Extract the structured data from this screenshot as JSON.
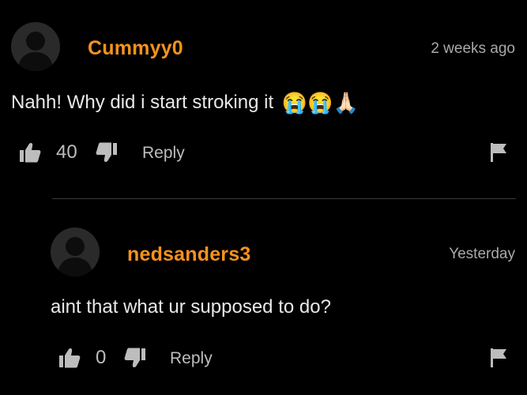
{
  "comments": [
    {
      "username": "Cummyy0",
      "time": "2 weeks ago",
      "text": "Nahh! Why did i start stroking it",
      "emojis": "😭😭🙏🏻",
      "likes": "40",
      "reply_label": "Reply"
    },
    {
      "username": "nedsanders3",
      "time": "Yesterday",
      "text": "aint that what ur supposed to do?",
      "likes": "0",
      "reply_label": "Reply"
    }
  ],
  "colors": {
    "username": "#f7921e",
    "background": "#000000",
    "muted": "#bdbdbd"
  },
  "icons": {
    "avatar": "default-avatar-silhouette",
    "like": "thumbs-up-icon",
    "dislike": "thumbs-down-icon",
    "report": "flag-icon"
  }
}
